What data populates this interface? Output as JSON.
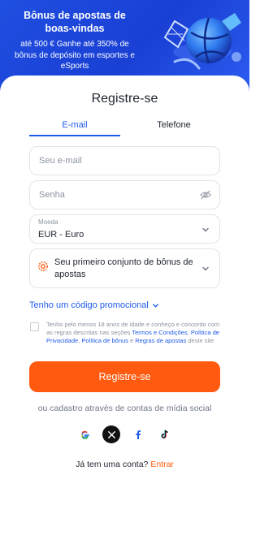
{
  "banner": {
    "title": "Bônus de apostas de boas-vindas",
    "subtitle": "até 500 € Ganhe até 350% de bônus de depósito em esportes e eSports"
  },
  "form": {
    "title": "Registre-se",
    "tabs": [
      {
        "label": "E-mail",
        "active": true
      },
      {
        "label": "Telefone",
        "active": false
      }
    ],
    "email_placeholder": "Seu e-mail",
    "password_placeholder": "Senha",
    "currency": {
      "label": "Moeda",
      "value": "EUR - Euro"
    },
    "bonus_select": "Seu primeiro conjunto de bônus de apostas",
    "promo_code_link": "Tenho um código promocional",
    "terms": {
      "prefix": "Tenho pelo menos 18 anos de idade e conheço e concordo com as regras descritas nas seções",
      "link1": "Termos e Condições",
      "sep1": ", ",
      "link2": "Política de Privacidade",
      "sep2": ", ",
      "link3": "Política de bônus",
      "sep3": " e ",
      "link4": "Regras de apostas",
      "suffix": " deste site"
    },
    "submit_label": "Registre-se",
    "social_label": "ou cadastro através de contas de mídia social",
    "socials": [
      "google-icon",
      "x-icon",
      "facebook-icon",
      "tiktok-icon"
    ],
    "login_prompt": "Já tem uma conta?",
    "login_link": "Entrar"
  },
  "colors": {
    "primary_blue": "#1f5bea",
    "accent_orange": "#ff5a0f",
    "banner_blue": "#1f4fe0"
  }
}
